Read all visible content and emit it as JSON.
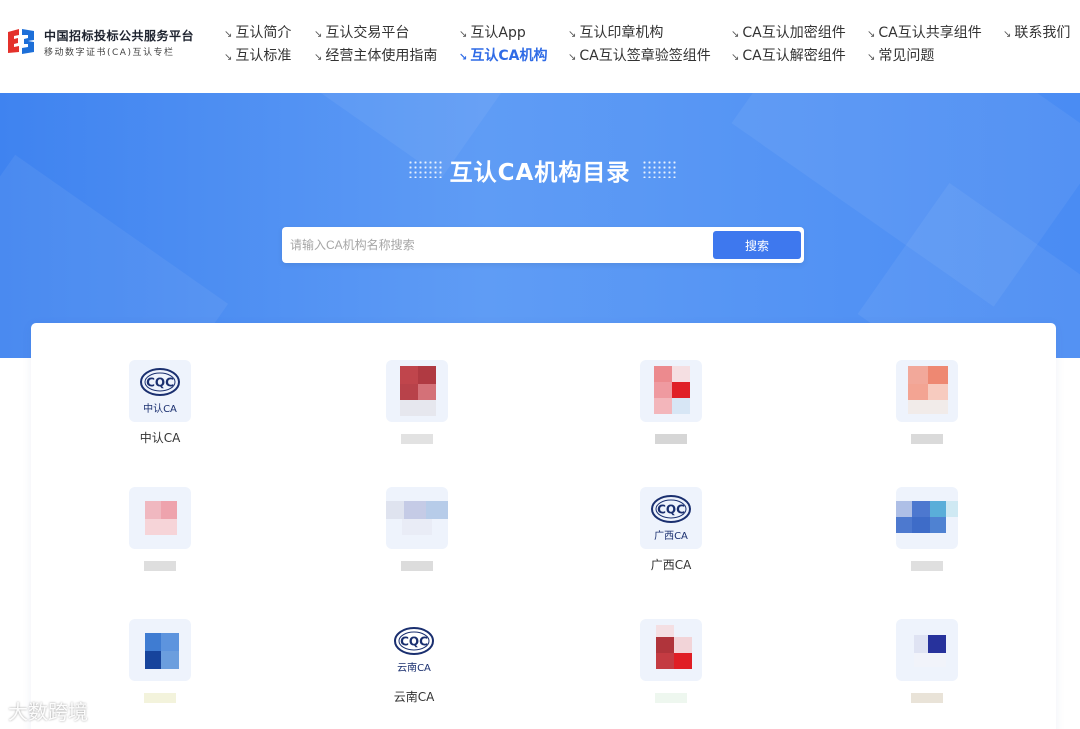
{
  "logo": {
    "title": "中国招标投标公共服务平台",
    "subtitle": "移动数字证书(CA)互认专栏",
    "icon": "platform-logo-icon"
  },
  "nav": [
    {
      "label": "互认简介"
    },
    {
      "label": "互认交易平台"
    },
    {
      "label": "互认App"
    },
    {
      "label": "互认印章机构"
    },
    {
      "label": "CA互认加密组件"
    },
    {
      "label": "CA互认共享组件"
    },
    {
      "label": "联系我们"
    },
    {
      "label": "互认标准"
    },
    {
      "label": "经营主体使用指南"
    },
    {
      "label": "互认CA机构",
      "active": true
    },
    {
      "label": "CA互认签章验签组件"
    },
    {
      "label": "CA互认解密组件"
    },
    {
      "label": "常见问题"
    }
  ],
  "nav_arrow": "↘",
  "banner": {
    "title": "互认CA机构目录",
    "search_placeholder": "请输入CA机构名称搜索",
    "search_button": "搜索"
  },
  "ca_logo_text": "CQC",
  "ca_items": [
    {
      "label": "中认CA",
      "logo_caption": "中认CA",
      "logo": "cqc"
    },
    {
      "label": "",
      "logo": "blurred"
    },
    {
      "label": "",
      "logo": "blurred"
    },
    {
      "label": "",
      "logo": "blurred"
    },
    {
      "label": "",
      "logo": "blurred"
    },
    {
      "label": "",
      "logo": "blurred"
    },
    {
      "label": "广西CA",
      "logo_caption": "广西CA",
      "logo": "cqc"
    },
    {
      "label": "",
      "logo": "blurred"
    },
    {
      "label": "",
      "logo": "blurred"
    },
    {
      "label": "云南CA",
      "logo_caption": "云南CA",
      "logo": "cqc"
    },
    {
      "label": "",
      "logo": "blurred"
    },
    {
      "label": "",
      "logo": "blurred"
    }
  ],
  "watermark": "大数跨境",
  "colors": {
    "accent": "#3e78ee",
    "banner": "#4a8cf3",
    "nav_active": "#2f6be6"
  }
}
